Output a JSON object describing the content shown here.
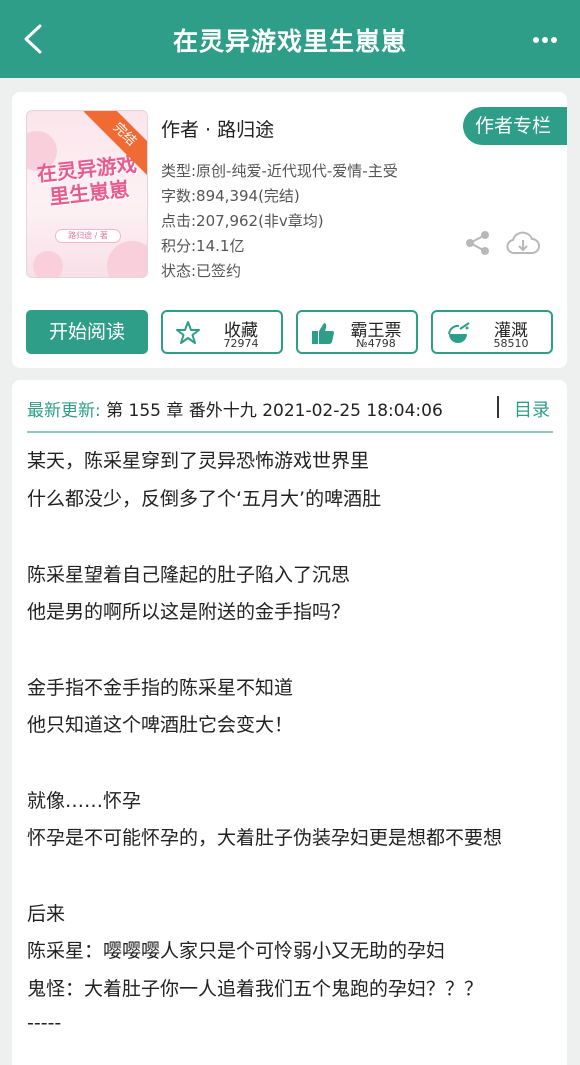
{
  "header": {
    "title": "在灵异游戏里生崽崽"
  },
  "book": {
    "cover_badge": "完结",
    "cover_title": "在灵异游戏里生崽崽",
    "cover_author": "路归途 / 著",
    "author": "作者 · 路归途",
    "author_column_button": "作者专栏",
    "type": "类型:原创-纯爱-近代现代-爱情-主受",
    "word_count": "字数:894,394(完结)",
    "clicks": "点击:207,962(非v章均)",
    "score": "积分:14.1亿",
    "status": "状态:已签约"
  },
  "actions": {
    "read_button": "开始阅读",
    "favorite": {
      "label": "收藏",
      "count": "72974"
    },
    "bawang": {
      "label": "霸王票",
      "count": "№4798"
    },
    "nutrient": {
      "label": "灌溉",
      "count": "58510"
    }
  },
  "update": {
    "label": "最新更新:",
    "value": "第 155 章  番外十九 2021-02-25 18:04:06",
    "toc": "目录"
  },
  "summary": [
    "某天，陈采星穿到了灵异恐怖游戏世界里",
    "什么都没少，反倒多了个‘五月大’的啤酒肚",
    "",
    "陈采星望着自己隆起的肚子陷入了沉思",
    "他是男的啊所以这是附送的金手指吗？",
    "",
    "金手指不金手指的陈采星不知道",
    "他只知道这个啤酒肚它会变大！",
    "",
    "就像……怀孕",
    "怀孕是不可能怀孕的，大着肚子伪装孕妇更是想都不要想",
    "",
    "后来",
    "陈采星：嘤嘤嘤人家只是个可怜弱小又无助的孕妇",
    "鬼怪：大着肚子你一人追着我们五个鬼跑的孕妇？？？",
    "-----"
  ],
  "colors": {
    "accent": "#2f9e88",
    "badge": "#f06b34"
  },
  "icons": [
    "back-arrow-icon",
    "more-dots-icon",
    "share-icon",
    "download-cloud-icon",
    "star-icon",
    "thumbs-up-icon",
    "watering-icon"
  ]
}
